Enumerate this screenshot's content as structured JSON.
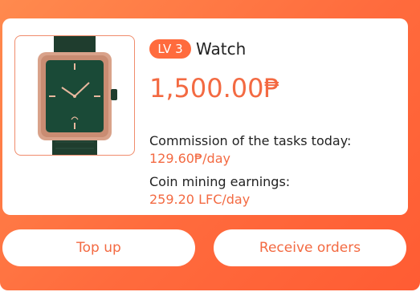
{
  "product": {
    "level_badge": "LV 3",
    "name": "Watch",
    "price": "1,500.00₱",
    "commission_label": "Commission of the tasks today:",
    "commission_value": "129.60₱/day",
    "mining_label": "Coin mining earnings:",
    "mining_value": "259.20 LFC/day",
    "image_icon": "watch-icon"
  },
  "actions": {
    "top_up_label": "Top up",
    "receive_orders_label": "Receive orders"
  },
  "colors": {
    "accent": "#f36a42",
    "background_gradient_start": "#ff8a4e",
    "background_gradient_end": "#ff5c33"
  }
}
